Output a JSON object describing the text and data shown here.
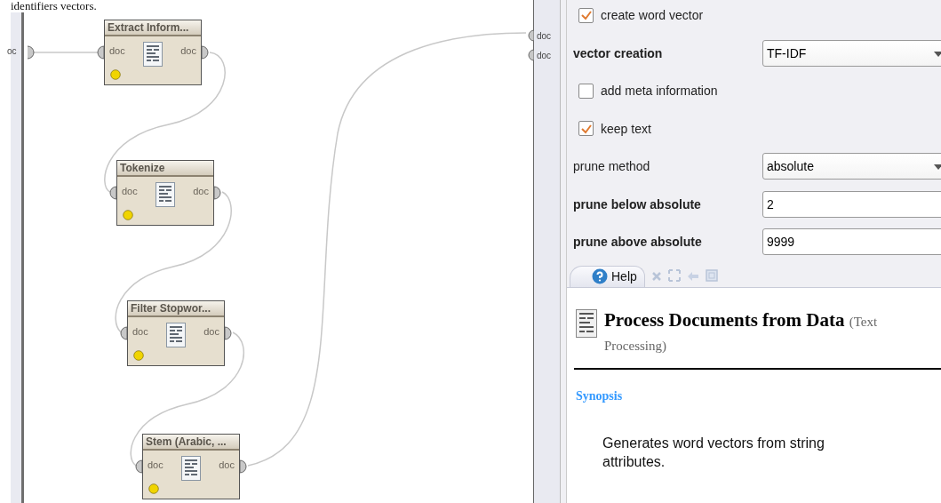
{
  "document_text": "identifiers vectors.",
  "process": {
    "source_port": "oc",
    "operators": [
      {
        "name": "Extract Inform...",
        "in_port": "doc",
        "out_port": "doc",
        "color": "#f0d400"
      },
      {
        "name": "Tokenize",
        "in_port": "doc",
        "out_port": "doc",
        "color": "#f0d400"
      },
      {
        "name": "Filter Stopwor...",
        "in_port": "doc",
        "out_port": "doc",
        "color": "#f0d400"
      },
      {
        "name": "Stem (Arabic, ...",
        "in_port": "doc",
        "out_port": "doc",
        "color": "#f0d400"
      }
    ],
    "sink_ports": [
      "doc",
      "doc"
    ]
  },
  "parameters": [
    {
      "kind": "checkbox",
      "label": "create word vector",
      "bold": false,
      "checked": true
    },
    {
      "kind": "select",
      "label": "vector creation",
      "bold": true,
      "value": "TF-IDF"
    },
    {
      "kind": "checkbox",
      "label": "add meta information",
      "bold": false,
      "checked": false
    },
    {
      "kind": "checkbox",
      "label": "keep text",
      "bold": false,
      "checked": true
    },
    {
      "kind": "select",
      "label": "prune method",
      "bold": false,
      "value": "absolute"
    },
    {
      "kind": "text",
      "label": "prune below absolute",
      "bold": true,
      "value": "2"
    },
    {
      "kind": "text",
      "label": "prune above absolute",
      "bold": true,
      "value": "9999"
    }
  ],
  "help": {
    "tab": "Help",
    "title": "Process Documents from Data",
    "subtitle": "(Text Processing)",
    "section": "Synopsis",
    "text": "Generates word vectors from string attributes."
  }
}
